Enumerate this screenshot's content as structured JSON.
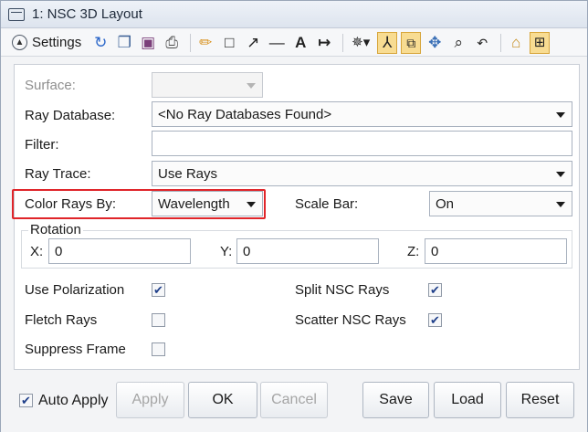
{
  "window": {
    "title": "1: NSC 3D Layout"
  },
  "toolbar": {
    "settings_label": "Settings",
    "icons": [
      "refresh-icon",
      "copy-icon",
      "save-icon",
      "print-icon",
      "pencil-icon",
      "rectangle-icon",
      "arrow-icon",
      "line-icon",
      "text-icon",
      "dimension-icon",
      "rotate-icon",
      "axes-icon",
      "fit-icon",
      "pan-icon",
      "zoom-icon",
      "reset-view-icon",
      "lock-icon",
      "window-icon"
    ],
    "text_tool": "A"
  },
  "form": {
    "surface": {
      "label": "Surface:",
      "value": ""
    },
    "ray_database": {
      "label": "Ray Database:",
      "value": "<No Ray Databases Found>"
    },
    "filter": {
      "label": "Filter:",
      "value": ""
    },
    "ray_trace": {
      "label": "Ray Trace:",
      "value": "Use Rays"
    },
    "color_rays_by": {
      "label": "Color Rays By:",
      "value": "Wavelength"
    },
    "scale_bar": {
      "label": "Scale Bar:",
      "value": "On"
    },
    "rotation": {
      "legend": "Rotation",
      "x": {
        "label": "X:",
        "value": "0"
      },
      "y": {
        "label": "Y:",
        "value": "0"
      },
      "z": {
        "label": "Z:",
        "value": "0"
      }
    },
    "options": {
      "use_polarization": {
        "label": "Use Polarization",
        "checked": true
      },
      "fletch_rays": {
        "label": "Fletch Rays",
        "checked": false
      },
      "suppress_frame": {
        "label": "Suppress Frame",
        "checked": false
      },
      "split_nsc_rays": {
        "label": "Split NSC Rays",
        "checked": true
      },
      "scatter_nsc_rays": {
        "label": "Scatter NSC Rays",
        "checked": true
      }
    }
  },
  "footer": {
    "auto_apply": {
      "label": "Auto Apply",
      "checked": true
    },
    "apply_label": "Apply",
    "ok_label": "OK",
    "cancel_label": "Cancel",
    "save_label": "Save",
    "load_label": "Load",
    "reset_label": "Reset"
  },
  "colors": {
    "highlight": "#e0252a",
    "active_tool": "#f8dc92",
    "check_mark": "#1f3f8a"
  }
}
